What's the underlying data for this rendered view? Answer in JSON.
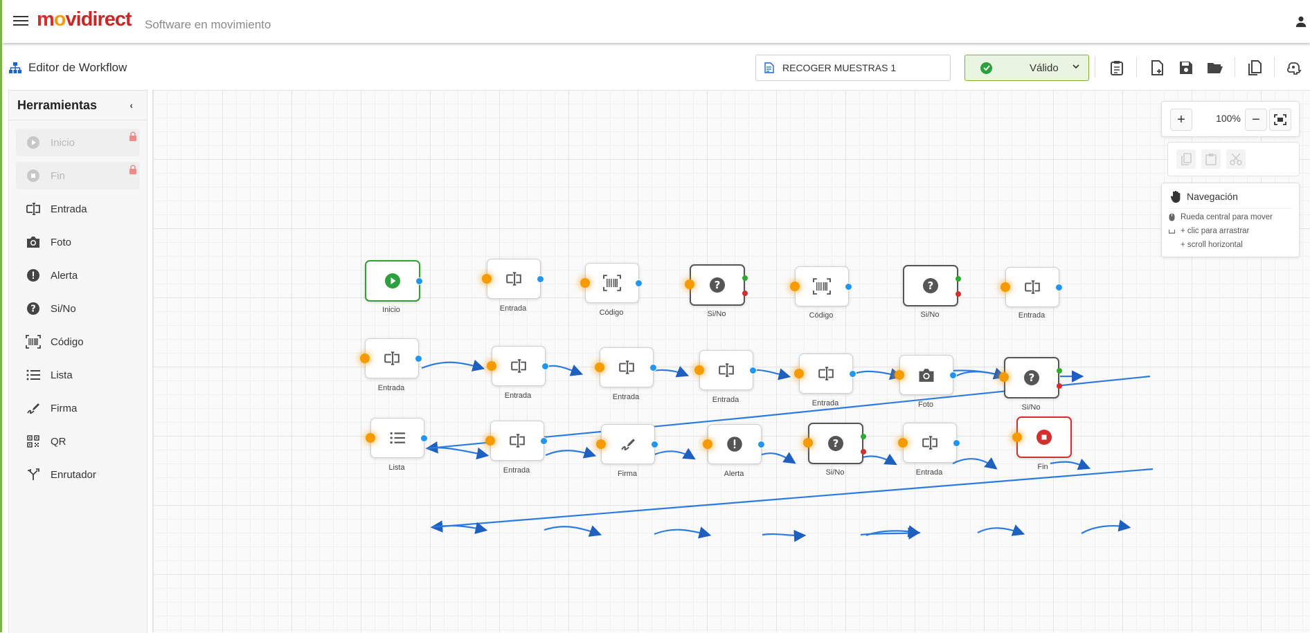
{
  "app": {
    "brand_m": "m",
    "brand_o": "o",
    "brand_rest": "vidirect",
    "tagline": "Software en movimiento"
  },
  "toolbar": {
    "page_title": "Editor de Workflow",
    "workflow_name": "RECOGER MUESTRAS 1",
    "status_value": "Válido"
  },
  "sidebar": {
    "title": "Herramientas",
    "items": [
      {
        "label": "Inicio",
        "icon": "play-circle-icon",
        "locked": true
      },
      {
        "label": "Fin",
        "icon": "stop-circle-icon",
        "locked": true
      },
      {
        "label": "Entrada",
        "icon": "text-input-icon",
        "locked": false
      },
      {
        "label": "Foto",
        "icon": "camera-icon",
        "locked": false
      },
      {
        "label": "Alerta",
        "icon": "alert-icon",
        "locked": false
      },
      {
        "label": "Si/No",
        "icon": "question-icon",
        "locked": false
      },
      {
        "label": "Código",
        "icon": "barcode-icon",
        "locked": false
      },
      {
        "label": "Lista",
        "icon": "list-icon",
        "locked": false
      },
      {
        "label": "Firma",
        "icon": "signature-icon",
        "locked": false
      },
      {
        "label": "QR",
        "icon": "qr-icon",
        "locked": false
      },
      {
        "label": "Enrutador",
        "icon": "router-icon",
        "locked": false
      }
    ]
  },
  "zoom": {
    "value": "100%"
  },
  "navigation": {
    "title": "Navegación",
    "hint_1": "Rueda central para mover",
    "hint_2": "+ clic para arrastrar",
    "hint_3": "+ scroll horizontal"
  },
  "workflow": {
    "nodes": [
      {
        "label": "Inicio",
        "type": "start"
      },
      {
        "label": "Entrada",
        "type": "input"
      },
      {
        "label": "Código",
        "type": "barcode"
      },
      {
        "label": "Si/No",
        "type": "decision"
      },
      {
        "label": "Código",
        "type": "barcode"
      },
      {
        "label": "Si/No",
        "type": "decision"
      },
      {
        "label": "Entrada",
        "type": "input"
      },
      {
        "label": "Entrada",
        "type": "input"
      },
      {
        "label": "Entrada",
        "type": "input"
      },
      {
        "label": "Entrada",
        "type": "input"
      },
      {
        "label": "Entrada",
        "type": "input"
      },
      {
        "label": "Entrada",
        "type": "input"
      },
      {
        "label": "Foto",
        "type": "photo"
      },
      {
        "label": "Si/No",
        "type": "decision"
      },
      {
        "label": "Lista",
        "type": "list"
      },
      {
        "label": "Entrada",
        "type": "input"
      },
      {
        "label": "Firma",
        "type": "signature"
      },
      {
        "label": "Alerta",
        "type": "alert"
      },
      {
        "label": "Si/No",
        "type": "decision"
      },
      {
        "label": "Entrada",
        "type": "input"
      },
      {
        "label": "Fin",
        "type": "end"
      }
    ]
  },
  "colors": {
    "accent_green": "#7cb342",
    "input_port": "#f59b00",
    "output_port": "#2196f3",
    "edge": "#1f5fbf"
  }
}
